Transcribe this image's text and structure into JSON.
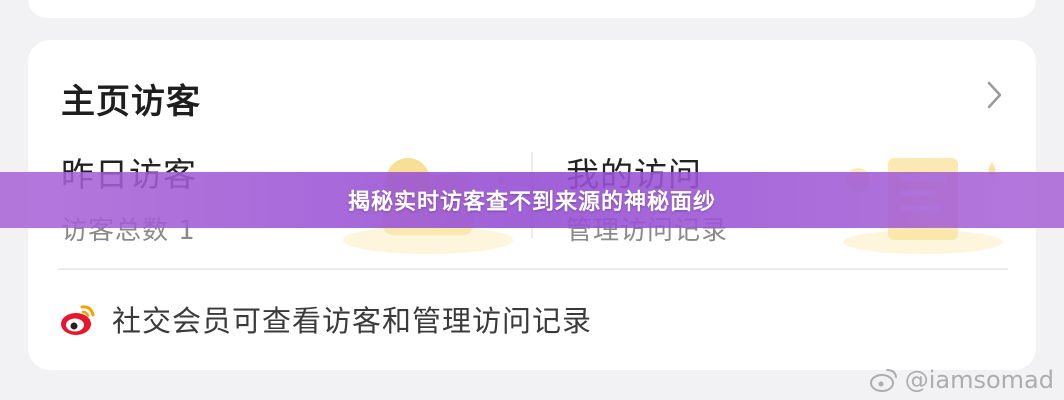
{
  "card": {
    "title": "主页访客",
    "chevron_icon": "chevron-right-icon"
  },
  "stats": {
    "left": {
      "title": "昨日访客",
      "subtitle": "访客总数 1"
    },
    "right": {
      "title": "我的访问",
      "subtitle": "管理访问记录"
    }
  },
  "footer": {
    "icon": "weibo-icon",
    "text": "社交会员可查看访客和管理访问记录"
  },
  "banner": {
    "text": "揭秘实时访客查不到来源的神秘面纱"
  },
  "watermark": {
    "text": "@iamsomad"
  },
  "colors": {
    "banner": "#9b5bd8",
    "illustration": "#f6d77a",
    "background": "#f2f2f4"
  }
}
